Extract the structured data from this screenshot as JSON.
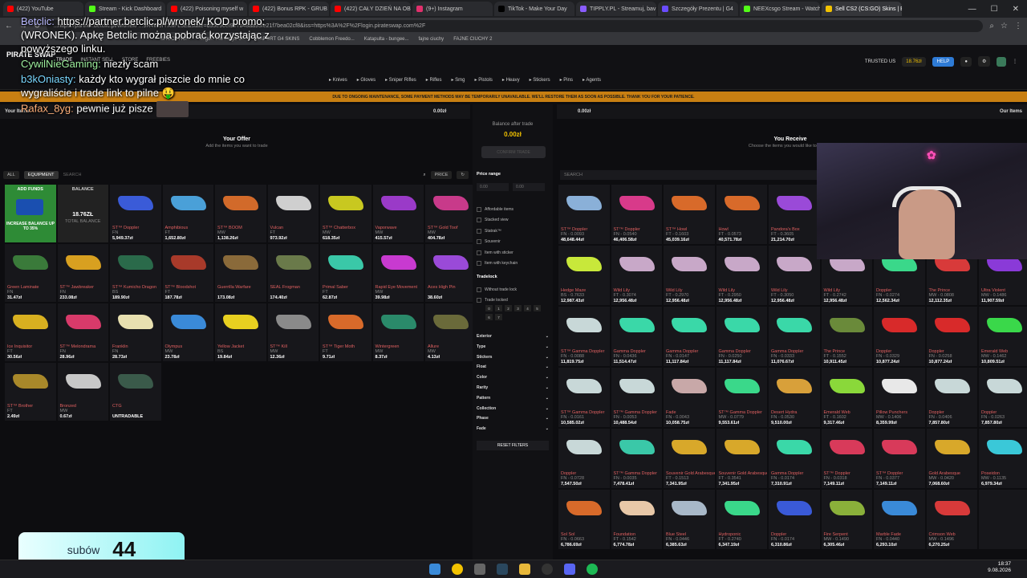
{
  "browser": {
    "tabs": [
      {
        "label": "(422) YouTube",
        "color": "#ff0000"
      },
      {
        "label": "Stream - Kick Dashboard",
        "color": "#53fc18"
      },
      {
        "label": "(422) Poisoning myself w",
        "color": "#ff0000"
      },
      {
        "label": "(422) Bonus RPK - GRUB",
        "color": "#ff0000"
      },
      {
        "label": "(422) CAŁY DZIEŃ NA OB",
        "color": "#ff0000"
      },
      {
        "label": "(9+) Instagram",
        "color": "#e1306c"
      },
      {
        "label": "TikTok - Make Your Day",
        "color": "#000000"
      },
      {
        "label": "TIPPLY.PL - Streamuj, bav",
        "color": "#8a5cff"
      },
      {
        "label": "Szczegóły Prezentu | G4",
        "color": "#6a4cff"
      },
      {
        "label": "NEEXcsgo Stream - Watch",
        "color": "#53fc18"
      },
      {
        "label": "Sell CS2 (CS:GO) Skins | B",
        "color": "#f2c200",
        "active": true
      }
    ],
    "url": "...https://partner.betclic.pl/wronek/ ...9R4W9fYXM-L5E&state=d55e90ef957b48aa93fe21f7bea02cf8&iss=https%3A%2F%2Flogin.pirateswap.com%2F",
    "bookmarks": [
      "SHOCK HO...",
      "Imgur: The magic of...",
      "RAPORT G4 SKINS",
      "Cobblemon Freedo...",
      "Katapulta - bungee...",
      "fajne ciuchy",
      "FAJNE CIUCHY 2"
    ]
  },
  "site": {
    "logo": "PIRATE SWAP",
    "nav": [
      "TRADE",
      "INSTANT SELL",
      "STORE",
      "FREEBIES"
    ],
    "trusted": "TRUSTED US",
    "balance": "18.76zł",
    "help": "HELP",
    "categories": [
      "Knives",
      "Gloves",
      "Sniper Rifles",
      "Rifles",
      "Smg",
      "Pistols",
      "Heavy",
      "Stickers",
      "Pins",
      "Agents"
    ],
    "banner": "DUE TO ONGOING MAINTENANCE, SOME PAYMENT METHODS MAY BE TEMPORARILY UNAVAILABLE. WE'LL RESTORE THEM AS SOON AS POSSIBLE. THANK YOU FOR YOUR PATIENCE."
  },
  "left": {
    "title": "Your Items",
    "balance": "0.00zł",
    "offer_title": "Your Offer",
    "offer_sub": "Add the items you want to trade",
    "filter_equipment": "EQUIPMENT",
    "search_placeholder": "SEARCH",
    "price_sort": "PRICE",
    "add_funds": "ADD FUNDS",
    "increase": "INCREASE BALANCE UP TO 35%",
    "balance_label": "BALANCE",
    "balance_value": "18.76ZŁ",
    "balance_sub": "TOTAL BALANCE",
    "items": [
      {
        "name": "ST™ Doppler",
        "wear": "FN",
        "price": "5,949.37zł",
        "color": "#3a5bd8"
      },
      {
        "name": "Amphibious",
        "wear": "FT",
        "price": "1,652.80zł",
        "color": "#4aa0d8"
      },
      {
        "name": "ST™ BOOM",
        "wear": "MW",
        "price": "1,138.26zł",
        "color": "#d26a2a"
      },
      {
        "name": "Vulcan",
        "wear": "FT",
        "price": "973.92zł",
        "color": "#cfcfcf"
      },
      {
        "name": "ST™ Chatterbox",
        "wear": "MW",
        "price": "618.35zł",
        "color": "#c8c820"
      },
      {
        "name": "Vaporwave",
        "wear": "MW",
        "price": "415.57zł",
        "color": "#9a3ac8"
      },
      {
        "name": "ST™ Gold Toof",
        "wear": "MW",
        "price": "404.78zł",
        "color": "#c83a8a"
      },
      {
        "name": "Green Laminate",
        "wear": "FN",
        "price": "31.47zł",
        "color": "#3a7a3a"
      },
      {
        "name": "ST™ Jawbreaker",
        "wear": "FN",
        "price": "233.08zł",
        "color": "#d8a020"
      },
      {
        "name": "ST™ Kumicho Dragon",
        "wear": "BS",
        "price": "189.90zł",
        "color": "#2a6a4a"
      },
      {
        "name": "ST™ Bloodshot",
        "wear": "FT",
        "price": "187.78zł",
        "color": "#a83a2a"
      },
      {
        "name": "Guerrilla Warfare",
        "wear": "",
        "price": "173.08zł",
        "color": "#8a6a3a"
      },
      {
        "name": "SEAL Frogman",
        "wear": "",
        "price": "174.40zł",
        "color": "#6a7a4a"
      },
      {
        "name": "Primal Saber",
        "wear": "FT",
        "price": "62.87zł",
        "color": "#3ac8a8"
      },
      {
        "name": "Rapid Eye Movement",
        "wear": "MW",
        "price": "39.98zł",
        "color": "#c83ad0"
      },
      {
        "name": "Aces High Pin",
        "wear": "",
        "price": "38.60zł",
        "color": "#9a4ad8"
      },
      {
        "name": "Ice Inquisitor",
        "wear": "FT",
        "price": "30.56zł",
        "color": "#d8b020"
      },
      {
        "name": "ST™ Melondrama",
        "wear": "FN",
        "price": "28.96zł",
        "color": "#d83a6a"
      },
      {
        "name": "Franklin",
        "wear": "FN",
        "price": "28.73zł",
        "color": "#e8e0b0"
      },
      {
        "name": "Olympus",
        "wear": "MW",
        "price": "23.78zł",
        "color": "#3a8ad8"
      },
      {
        "name": "Yellow Jacket",
        "wear": "BS",
        "price": "19.84zł",
        "color": "#e8d020"
      },
      {
        "name": "ST™ Kill",
        "wear": "MW",
        "price": "12.36zł",
        "color": "#8a8a8a"
      },
      {
        "name": "ST™ Tiger Moth",
        "wear": "FT",
        "price": "9.71zł",
        "color": "#d86a2a"
      },
      {
        "name": "Wintergreen",
        "wear": "MW",
        "price": "8.37zł",
        "color": "#2a8a6a"
      },
      {
        "name": "Allure",
        "wear": "MW",
        "price": "4.13zł",
        "color": "#6a6a3a"
      },
      {
        "name": "ST™ Brother",
        "wear": "FT",
        "price": "2.49zł",
        "color": "#a8882a"
      },
      {
        "name": "Bronzed",
        "wear": "MW",
        "price": "0.67zł",
        "color": "#c8c8c8"
      },
      {
        "name": "CTG",
        "wear": "",
        "price": "UNTRADABLE",
        "color": "#3a5a4a"
      }
    ]
  },
  "middle": {
    "balance_after_label": "Balance after trade",
    "balance_after": "0.00zł",
    "trade_button": "CONFIRM TRADE",
    "price_range": "Price range",
    "min": "0.00",
    "max": "0.00",
    "checks": [
      "Affordable items",
      "Stacked view",
      "Statrak™",
      "Souvenir",
      "Item with sticker",
      "Item with keychain"
    ],
    "tradelock": "Tradelock",
    "tradelock_checks": [
      "Without trade lock",
      "Trade locked"
    ],
    "lock_days": [
      "0",
      "1",
      "2",
      "3",
      "4",
      "5",
      "6",
      "7"
    ],
    "filters": [
      "Exterior",
      "Type",
      "Stickers",
      "Float",
      "Color",
      "Rarity",
      "Pattern",
      "Collection",
      "Phase",
      "Fade"
    ],
    "reset": "RESET FILTERS"
  },
  "right": {
    "balance": "0.00zł",
    "our_items": "Our Items",
    "receive_title": "You Receive",
    "receive_sub": "Choose the items you would like to receive",
    "search_placeholder": "SEARCH",
    "items": [
      {
        "name": "ST™ Doppler",
        "wear": "FN - 0.0093",
        "price": "48,648.44zł",
        "color": "#8ab0d8"
      },
      {
        "name": "ST™ Doppler",
        "wear": "FN - 0.0540",
        "price": "46,406.58zł",
        "color": "#d83a8a"
      },
      {
        "name": "ST™ Howl",
        "wear": "FT - 0.1603",
        "price": "45,039.16zł",
        "color": "#d86a2a"
      },
      {
        "name": "Howl",
        "wear": "FT - 0.0573",
        "price": "40,571.78zł",
        "color": "#d86a2a"
      },
      {
        "name": "Pandora's Box",
        "wear": "FT - 0.3605",
        "price": "21,214.70zł",
        "color": "#9a4ad8"
      },
      {
        "name": "",
        "wear": "",
        "price": "",
        "color": "#222"
      },
      {
        "name": "",
        "wear": "",
        "price": "",
        "color": "#222"
      },
      {
        "name": "",
        "wear": "",
        "price": "",
        "color": "#222"
      },
      {
        "name": "",
        "wear": "",
        "price": "",
        "color": "#222"
      },
      {
        "name": "Hedge Maze",
        "wear": "BS - 0.7633",
        "price": "12,987.43zł",
        "color": "#c8e83a"
      },
      {
        "name": "Wild Lily",
        "wear": "FT - 0.3074",
        "price": "12,956.48zł",
        "color": "#c8a8c8"
      },
      {
        "name": "Wild Lily",
        "wear": "FT - 0.2970",
        "price": "12,956.48zł",
        "color": "#c8a8c8"
      },
      {
        "name": "Wild Lily",
        "wear": "FT - 0.2950",
        "price": "12,956.48zł",
        "color": "#c8a8c8"
      },
      {
        "name": "Wild Lily",
        "wear": "FT - 0.3050",
        "price": "12,956.48zł",
        "color": "#c8a8c8"
      },
      {
        "name": "Wild Lily",
        "wear": "FT - 0.2742",
        "price": "12,956.48zł",
        "color": "#c8a8c8"
      },
      {
        "name": "Doppler",
        "wear": "FN - 0.0274",
        "price": "12,562.34zł",
        "color": "#3ad88a"
      },
      {
        "name": "The Prince",
        "wear": "MW - 0.0808",
        "price": "12,112.35zł",
        "color": "#d83a3a"
      },
      {
        "name": "Ultra Violent",
        "wear": "MW - 0.1486",
        "price": "11,907.59zł",
        "color": "#8a3ad8"
      },
      {
        "name": "ST™ Gamma Doppler",
        "wear": "FN - 0.0088",
        "price": "11,819.75zł",
        "color": "#c8d8d8"
      },
      {
        "name": "Gamma Doppler",
        "wear": "FN - 0.0436",
        "price": "11,514.47zł",
        "color": "#3ad8a8"
      },
      {
        "name": "Gamma Doppler",
        "wear": "FN - 0.0147",
        "price": "11,117.84zł",
        "color": "#3ad8a8"
      },
      {
        "name": "Gamma Doppler",
        "wear": "FN - 0.0250",
        "price": "11,117.84zł",
        "color": "#3ad8a8"
      },
      {
        "name": "Gamma Doppler",
        "wear": "FN - 0.0333",
        "price": "11,076.67zł",
        "color": "#3ad8a8"
      },
      {
        "name": "The Prince",
        "wear": "FT - 0.1552",
        "price": "10,911.45zł",
        "color": "#6a8a3a"
      },
      {
        "name": "Doppler",
        "wear": "FN - 0.0329",
        "price": "10,877.24zł",
        "color": "#d82a2a"
      },
      {
        "name": "Doppler",
        "wear": "FN - 0.0258",
        "price": "10,877.24zł",
        "color": "#d82a2a"
      },
      {
        "name": "Emerald Web",
        "wear": "MW - 0.1462",
        "price": "10,809.51zł",
        "color": "#3ad84a"
      },
      {
        "name": "ST™ Gamma Doppler",
        "wear": "FN - 0.0161",
        "price": "10,585.02zł",
        "color": "#c8d8d8"
      },
      {
        "name": "ST™ Gamma Doppler",
        "wear": "FN - 0.0053",
        "price": "10,488.54zł",
        "color": "#c8d8d8"
      },
      {
        "name": "Fade",
        "wear": "FN - 0.0043",
        "price": "10,058.75zł",
        "color": "#c8a8a8"
      },
      {
        "name": "ST™ Gamma Doppler",
        "wear": "MW - 0.0779",
        "price": "9,553.61zł",
        "color": "#3ad88a"
      },
      {
        "name": "Desert Hydra",
        "wear": "FN - 0.0530",
        "price": "9,510.00zł",
        "color": "#d8a03a"
      },
      {
        "name": "Emerald Web",
        "wear": "FT - 0.1602",
        "price": "9,317.46zł",
        "color": "#8ad83a"
      },
      {
        "name": "Pillow Punchers",
        "wear": "MW - 0.1406",
        "price": "8,359.99zł",
        "color": "#e8e8e8"
      },
      {
        "name": "Doppler",
        "wear": "FN - 0.0406",
        "price": "7,857.80zł",
        "color": "#c8d8d8"
      },
      {
        "name": "Doppler",
        "wear": "FN - 0.0263",
        "price": "7,857.80zł",
        "color": "#c8d8d8"
      },
      {
        "name": "Doppler",
        "wear": "FN - 0.0728",
        "price": "7,547.50zł",
        "color": "#c8d8d8"
      },
      {
        "name": "ST™ Gamma Doppler",
        "wear": "FN - 0.0035",
        "price": "7,478.41zł",
        "color": "#3ac8a8"
      },
      {
        "name": "Souvenir Gold Arabesque",
        "wear": "FT - 0.1513",
        "price": "7,341.95zł",
        "color": "#d8a82a"
      },
      {
        "name": "Souvenir Gold Arabesque",
        "wear": "FT - 0.3541",
        "price": "7,341.95zł",
        "color": "#d8a82a"
      },
      {
        "name": "Gamma Doppler",
        "wear": "FN - 0.0174",
        "price": "7,310.91zł",
        "color": "#3ad8a8"
      },
      {
        "name": "ST™ Doppler",
        "wear": "FN - 0.0318",
        "price": "7,149.11zł",
        "color": "#d83a5a"
      },
      {
        "name": "ST™ Doppler",
        "wear": "FN - 0.0377",
        "price": "7,149.11zł",
        "color": "#d83a5a"
      },
      {
        "name": "Gold Arabesque",
        "wear": "MW - 0.0420",
        "price": "7,068.60zł",
        "color": "#d8a82a"
      },
      {
        "name": "Poseidon",
        "wear": "MW - 0.1135",
        "price": "6,979.34zł",
        "color": "#3ac8d8"
      },
      {
        "name": "Sol Sol",
        "wear": "FN - 0.0663",
        "price": "6,786.69zł",
        "color": "#d86a2a"
      },
      {
        "name": "Foundation",
        "wear": "FT - 0.1542",
        "price": "6,774.78zł",
        "color": "#e8c8a8"
      },
      {
        "name": "Blue Steel",
        "wear": "FN - 0.0446",
        "price": "6,385.63zł",
        "color": "#a8b8c8"
      },
      {
        "name": "Hydroponic",
        "wear": "FT - 0.2740",
        "price": "6,347.19zł",
        "color": "#3ad88a"
      },
      {
        "name": "Doppler",
        "wear": "FN - 0.0174",
        "price": "6,310.86zł",
        "color": "#3a5ad8"
      },
      {
        "name": "Fire Serpent",
        "wear": "MW - 0.1490",
        "price": "6,305.46zł",
        "color": "#8ab03a"
      },
      {
        "name": "Marble Fade",
        "wear": "FN - 0.0440",
        "price": "6,293.10zł",
        "color": "#3a8ad8"
      },
      {
        "name": "Crimson Web",
        "wear": "MW - 0.1496",
        "price": "6,270.25zł",
        "color": "#d83a3a"
      },
      {
        "name": "",
        "wear": "",
        "price": "",
        "color": "#222"
      }
    ]
  },
  "chat": {
    "lines": [
      {
        "user": "Betclic:",
        "text": "https://partner.betclic.pl/wronek/ KOD promo: (WRONEK). Apkę Betclic można pobrać korzystając z powyższego linku."
      },
      {
        "user": "CywilNieGaming:",
        "text": "niezły scam"
      },
      {
        "user": "b3kOniasty:",
        "text": "każdy kto wygrał piszcie do mnie co wygraliście i trade link to pilne 🤑"
      },
      {
        "user": "Rafax_8yg:",
        "text": "pewnie już pisze"
      }
    ]
  },
  "overlay": {
    "sub_label": "subów",
    "sub_count": "44"
  },
  "taskbar": {
    "time": "18:37",
    "date": "9.08.2026"
  }
}
